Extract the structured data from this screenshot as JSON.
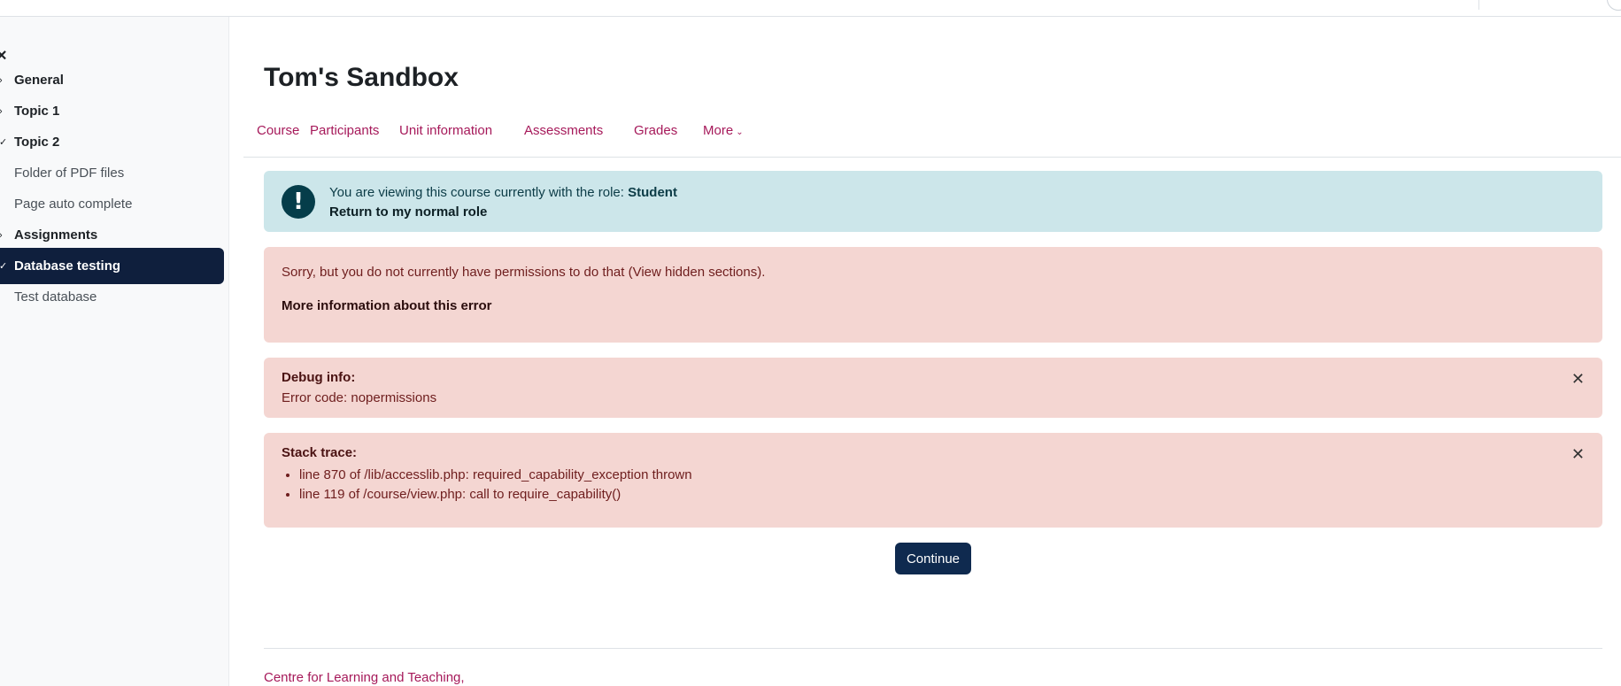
{
  "sidebar": {
    "close_icon_glyph": "×",
    "items": [
      {
        "label": "General",
        "kind": "section",
        "chevron": "›"
      },
      {
        "label": "Topic 1",
        "kind": "section",
        "chevron": "›"
      },
      {
        "label": "Topic 2",
        "kind": "section",
        "chevron": "✓"
      },
      {
        "label": "Folder of PDF files",
        "kind": "activity"
      },
      {
        "label": "Page auto complete",
        "kind": "activity"
      },
      {
        "label": "Assignments",
        "kind": "section",
        "chevron": "›"
      },
      {
        "label": "Database testing",
        "kind": "section",
        "chevron": "✓",
        "active": true
      },
      {
        "label": "Test database",
        "kind": "activity"
      }
    ]
  },
  "header": {
    "title": "Tom's Sandbox"
  },
  "tabs": [
    {
      "label": "Course"
    },
    {
      "label": "Participants"
    },
    {
      "label": "Unit information"
    },
    {
      "label": "Assessments"
    },
    {
      "label": "Grades"
    },
    {
      "label": "More",
      "dropdown": true
    }
  ],
  "role_notice": {
    "icon": "exclamation-icon",
    "text": "You are viewing this course currently with the role: ",
    "role": "Student",
    "return_label": "Return to my normal role"
  },
  "error": {
    "message": "Sorry, but you do not currently have permissions to do that (View hidden sections).",
    "more_info": "More information about this error"
  },
  "debug": {
    "title": "Debug info:",
    "code": "Error code: nopermissions"
  },
  "stack": {
    "title": "Stack trace:",
    "lines": [
      "line 870 of /lib/accesslib.php: required_capability_exception thrown",
      "line 119 of /course/view.php: call to require_capability()"
    ]
  },
  "actions": {
    "continue_label": "Continue"
  },
  "footer": {
    "link": "Centre for Learning and Teaching,"
  },
  "colors": {
    "accent_link": "#a6195a",
    "primary_button": "#0f2a4f",
    "info_bg": "#cce6ea",
    "danger_bg": "#f4d6d2",
    "active_nav_bg": "#0f1f3d"
  }
}
